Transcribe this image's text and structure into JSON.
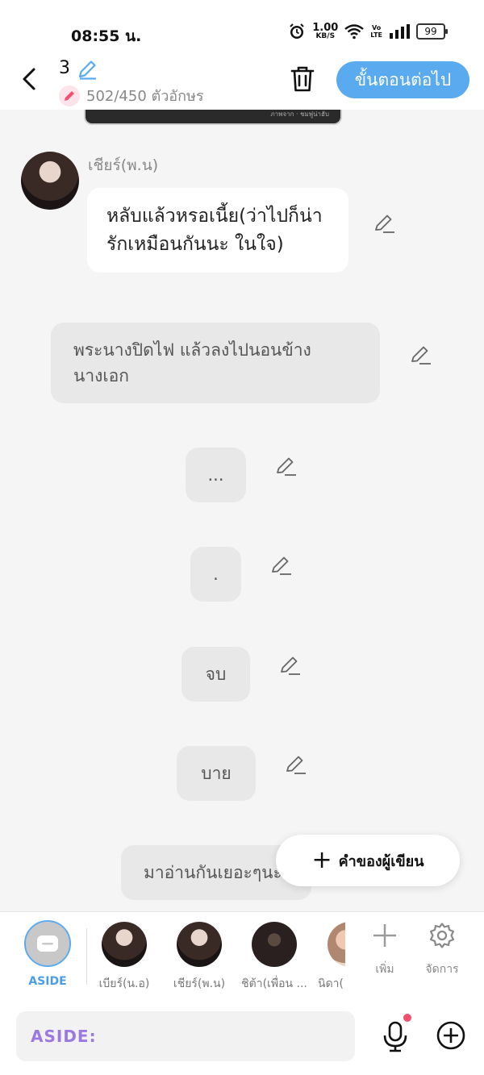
{
  "status_bar": {
    "time": "08:55 น.",
    "net_speed": "1.00",
    "net_unit": "KB/S",
    "volte_top": "Vo",
    "volte_bottom": "LTE",
    "battery": "99"
  },
  "header": {
    "chapter_number": "3",
    "char_count": "502/450 ตัวอักษร",
    "next_button": "ขั้นตอนต่อไป"
  },
  "preview_caption": "ภาพจาก · ชมพู่น่าฮับ",
  "messages": {
    "speaker": "เชียร์(พ.น)",
    "dialogue": "หลับแล้วหรอเนี้ย(ว่าไปก็น่ารักเหมือนกันนะ ในใจ)",
    "narration": "พระนางปิดไฟ แล้วลงไปนอนข้างนางเอก",
    "short_1": "...",
    "short_2": ".",
    "short_3": "จบ",
    "short_4": "บาย",
    "last": "มาอ่านกันเยอะๆนะ"
  },
  "fab_label": "คำของผู้เขียน",
  "characters": {
    "aside": "ASIDE",
    "items": [
      "เบียร์(น.อ)",
      "เชียร์(พ.น)",
      "ชิต้า(เพื่อน ...",
      "นิดา("
    ],
    "add_label": "เพิ่ม",
    "manage_label": "จัดการ"
  },
  "input": {
    "prefix": "ASIDE:"
  },
  "colors": {
    "accent": "#5aaaf0",
    "pink": "#f0506e",
    "aside_gradient": "#9a7ae0"
  }
}
